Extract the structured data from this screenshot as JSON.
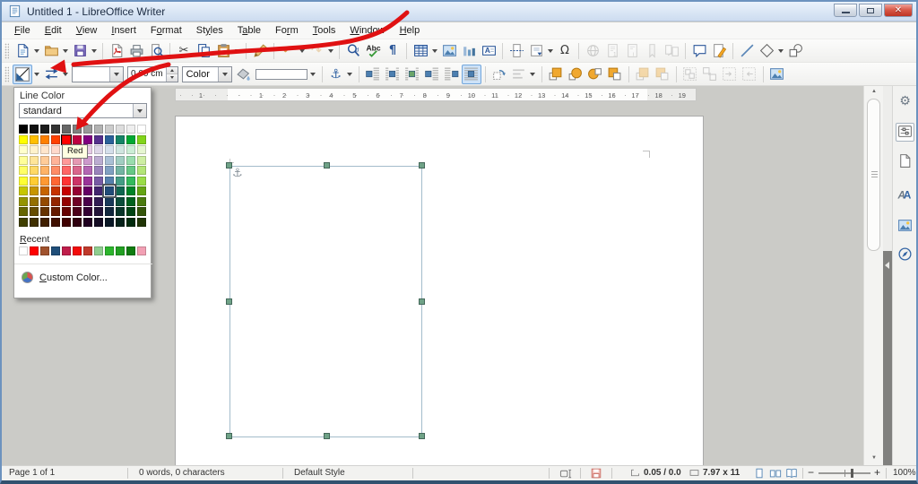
{
  "window": {
    "title": "Untitled 1 - LibreOffice Writer"
  },
  "window_controls": [
    {
      "name": "minimize-button"
    },
    {
      "name": "maximize-button"
    },
    {
      "name": "close-button"
    }
  ],
  "menu": {
    "items": [
      {
        "label": "File",
        "accel_index": 0
      },
      {
        "label": "Edit",
        "accel_index": 0
      },
      {
        "label": "View",
        "accel_index": 0
      },
      {
        "label": "Insert",
        "accel_index": 0
      },
      {
        "label": "Format",
        "accel_index": 1
      },
      {
        "label": "Styles",
        "accel_index": 2
      },
      {
        "label": "Table",
        "accel_index": 1
      },
      {
        "label": "Form",
        "accel_index": 2
      },
      {
        "label": "Tools",
        "accel_index": 0
      },
      {
        "label": "Window",
        "accel_index": 0
      },
      {
        "label": "Help",
        "accel_index": 0
      }
    ]
  },
  "toolbar_standard": {
    "buttons": [
      {
        "name": "new-document-button",
        "icon": "doc-new",
        "dropdown": true
      },
      {
        "name": "open-button",
        "icon": "folder",
        "dropdown": true
      },
      {
        "name": "save-button",
        "icon": "floppy",
        "dropdown": true
      },
      {
        "type": "sep"
      },
      {
        "name": "export-pdf-button",
        "icon": "pdf"
      },
      {
        "name": "print-button",
        "icon": "printer"
      },
      {
        "name": "print-preview-button",
        "icon": "preview"
      },
      {
        "type": "sep"
      },
      {
        "name": "cut-button",
        "icon": "scissors"
      },
      {
        "name": "copy-button",
        "icon": "copy"
      },
      {
        "name": "paste-button",
        "icon": "clipboard",
        "dropdown": true
      },
      {
        "type": "sep"
      },
      {
        "name": "clone-formatting-button",
        "icon": "brush"
      },
      {
        "type": "sep"
      },
      {
        "name": "undo-button",
        "icon": "undo",
        "dropdown": true
      },
      {
        "name": "redo-button",
        "icon": "redo",
        "dropdown": true,
        "disabled": true
      },
      {
        "type": "sep"
      },
      {
        "name": "find-replace-button",
        "icon": "find"
      },
      {
        "name": "spelling-button",
        "icon": "spelling"
      },
      {
        "name": "formatting-marks-button",
        "icon": "pilcrow"
      },
      {
        "type": "sep"
      },
      {
        "name": "insert-table-button",
        "icon": "table",
        "dropdown": true
      },
      {
        "name": "insert-image-button",
        "icon": "image"
      },
      {
        "name": "insert-chart-button",
        "icon": "chart"
      },
      {
        "name": "insert-textbox-button",
        "icon": "textbox"
      },
      {
        "type": "sep"
      },
      {
        "name": "insert-page-break-button",
        "icon": "pagebreak"
      },
      {
        "name": "insert-field-button",
        "icon": "field",
        "dropdown": true
      },
      {
        "name": "insert-special-character-button",
        "icon": "omega"
      },
      {
        "type": "sep"
      },
      {
        "name": "insert-hyperlink-button",
        "icon": "hyperlink",
        "disabled": true
      },
      {
        "name": "insert-footnote-button",
        "icon": "footnote",
        "disabled": true
      },
      {
        "name": "insert-endnote-button",
        "icon": "endnote",
        "disabled": true
      },
      {
        "name": "insert-bookmark-button",
        "icon": "bookmark",
        "disabled": true
      },
      {
        "name": "insert-cross-reference-button",
        "icon": "crossref",
        "disabled": true
      },
      {
        "type": "sep"
      },
      {
        "name": "insert-comment-button",
        "icon": "comment"
      },
      {
        "name": "track-changes-button",
        "icon": "trackchanges"
      },
      {
        "type": "sep"
      },
      {
        "name": "insert-line-button",
        "icon": "line"
      },
      {
        "name": "basic-shapes-button",
        "icon": "shapes",
        "dropdown": true
      },
      {
        "name": "draw-functions-button",
        "icon": "draw"
      }
    ]
  },
  "toolbar_frame": {
    "line_width_value": "0.00 cm",
    "area_style_value": "Color",
    "buttons": [
      {
        "name": "line-color-button",
        "icon": "linecolor",
        "dropdown": true,
        "pressed": true
      },
      {
        "name": "arrow-style-button",
        "icon": "arrowstyle",
        "dropdown": true
      },
      {
        "type": "linestyle-combo",
        "name": "line-style-combo"
      },
      {
        "type": "spinner",
        "name": "line-width-spinner"
      },
      {
        "type": "area-combo",
        "name": "area-style-combo"
      },
      {
        "name": "fill-color-button",
        "icon": "bucket",
        "swatch": "#FFFFFF",
        "dropdown": true
      },
      {
        "type": "sep"
      },
      {
        "name": "anchor-button",
        "icon": "anchor",
        "dropdown": true
      },
      {
        "type": "sep"
      },
      {
        "name": "wrap-off-button",
        "icon": "wrap1"
      },
      {
        "name": "wrap-on-button",
        "icon": "wrap2"
      },
      {
        "name": "wrap-ideal-button",
        "icon": "wrap3"
      },
      {
        "name": "wrap-left-button",
        "icon": "wrap4"
      },
      {
        "name": "wrap-right-button",
        "icon": "wrap5"
      },
      {
        "name": "wrap-through-button",
        "icon": "wrap6",
        "pressed": true
      },
      {
        "type": "sep"
      },
      {
        "name": "rotate-button",
        "icon": "rotate"
      },
      {
        "name": "align-objects-button",
        "icon": "align",
        "dropdown": true,
        "disabled": true
      },
      {
        "type": "sep"
      },
      {
        "name": "bring-to-front-button",
        "icon": "tofront"
      },
      {
        "name": "forward-one-button",
        "icon": "forward"
      },
      {
        "name": "back-one-button",
        "icon": "backward"
      },
      {
        "name": "send-to-back-button",
        "icon": "toback"
      },
      {
        "type": "sep"
      },
      {
        "name": "to-foreground-button",
        "icon": "tofront",
        "disabled": true
      },
      {
        "name": "to-background-button",
        "icon": "toback",
        "disabled": true
      },
      {
        "type": "sep"
      },
      {
        "name": "group-button",
        "icon": "group",
        "disabled": true
      },
      {
        "name": "ungroup-button",
        "icon": "ungroup",
        "disabled": true
      },
      {
        "name": "enter-group-button",
        "icon": "entergroup",
        "disabled": true
      },
      {
        "name": "exit-group-button",
        "icon": "exitgroup",
        "disabled": true
      },
      {
        "type": "sep"
      },
      {
        "name": "frame-properties-button",
        "icon": "image"
      }
    ]
  },
  "line_color_popup": {
    "title": "Line Color",
    "palette_name": "standard",
    "hovered_swatch": {
      "row": 1,
      "col": 4,
      "name": "Red"
    },
    "selected_swatch": {
      "row": 6,
      "col": 8,
      "name": "Dark Blue 1"
    },
    "tooltip": "Red",
    "recent_label": "Recent",
    "custom_label": "Custom Color...",
    "custom_accel_index": 0,
    "palette_rows": [
      [
        "#000000",
        "#111111",
        "#1C1C1C",
        "#333333",
        "#666666",
        "#808080",
        "#999999",
        "#B2B2B2",
        "#CCCCCC",
        "#DDDDDD",
        "#EEEEEE",
        "#FFFFFF"
      ],
      [
        "#FFFF00",
        "#FFBF00",
        "#FF8000",
        "#FF4000",
        "#FF0000",
        "#BF0041",
        "#800080",
        "#55308D",
        "#2A6099",
        "#158466",
        "#00A933",
        "#81D41A"
      ],
      [
        "#FFFFCC",
        "#FFF2CC",
        "#FFE6CC",
        "#FFD9CC",
        "#FFCCCC",
        "#F2CCD9",
        "#E6CCE6",
        "#DDD6E8",
        "#D5DFEB",
        "#D0E6E0",
        "#CCEED6",
        "#E6F6D1"
      ],
      [
        "#FFFF99",
        "#FFE599",
        "#FFCC99",
        "#FFB399",
        "#FF9999",
        "#E599B3",
        "#CC99CC",
        "#BBACD1",
        "#AAC0D6",
        "#A1CEC2",
        "#99DDAD",
        "#CDEEA3"
      ],
      [
        "#FFFF66",
        "#FFD966",
        "#FFB366",
        "#FF8C66",
        "#FF6666",
        "#D9668C",
        "#B366B3",
        "#9983BB",
        "#80A0C2",
        "#73B5A3",
        "#66C985",
        "#B3E578"
      ],
      [
        "#FFFF33",
        "#FFCC33",
        "#FF9933",
        "#FF6633",
        "#FF3333",
        "#CC3367",
        "#993399",
        "#775AA4",
        "#5580AD",
        "#449D85",
        "#33BA5C",
        "#9ADD48"
      ],
      [
        "#C7C700",
        "#C79500",
        "#C76400",
        "#C73200",
        "#C70000",
        "#950033",
        "#640064",
        "#42256E",
        "#214B78",
        "#106750",
        "#008428",
        "#65A514"
      ],
      [
        "#949400",
        "#946F00",
        "#944A00",
        "#942500",
        "#940000",
        "#6F0026",
        "#4A004A",
        "#311C52",
        "#183859",
        "#0C4D3B",
        "#00621E",
        "#4B7B0F"
      ],
      [
        "#666600",
        "#664C00",
        "#663300",
        "#661A00",
        "#660000",
        "#4C001A",
        "#330033",
        "#221338",
        "#11263D",
        "#083529",
        "#004414",
        "#34550A"
      ],
      [
        "#404000",
        "#403000",
        "#402000",
        "#401000",
        "#400000",
        "#300010",
        "#200020",
        "#150C23",
        "#0A1826",
        "#052119",
        "#002A0D",
        "#203506"
      ]
    ],
    "recent_colors": [
      "#FFFFFF",
      "#FF0000",
      "#A0522D",
      "#1F4E79",
      "#BF1E4B",
      "#F30B0B",
      "#C0392B",
      "#8FCE8F",
      "#2CB52C",
      "#22A022",
      "#107C10",
      "#F2A0B4"
    ]
  },
  "ruler": {
    "margin_number": "1",
    "numbers": [
      "1",
      "2",
      "3",
      "4",
      "5",
      "6",
      "7",
      "8",
      "9",
      "10",
      "11",
      "12",
      "13",
      "14",
      "15",
      "16",
      "17",
      "18",
      "19"
    ]
  },
  "sidebar": {
    "tabs": [
      {
        "name": "sidebar-settings-tab",
        "icon": "gear"
      },
      {
        "name": "properties-tab",
        "icon": "properties",
        "active": true
      },
      {
        "name": "page-tab",
        "icon": "pagetab"
      },
      {
        "name": "styles-tab",
        "icon": "styles"
      },
      {
        "name": "gallery-tab",
        "icon": "gallery"
      },
      {
        "name": "navigator-tab",
        "icon": "navigator"
      }
    ]
  },
  "status_bar": {
    "page": "Page 1 of 1",
    "words": "0 words, 0 characters",
    "style": "Default Style",
    "position": "0.05 / 0.0",
    "size": "7.97 x 11",
    "zoom": "100%"
  }
}
